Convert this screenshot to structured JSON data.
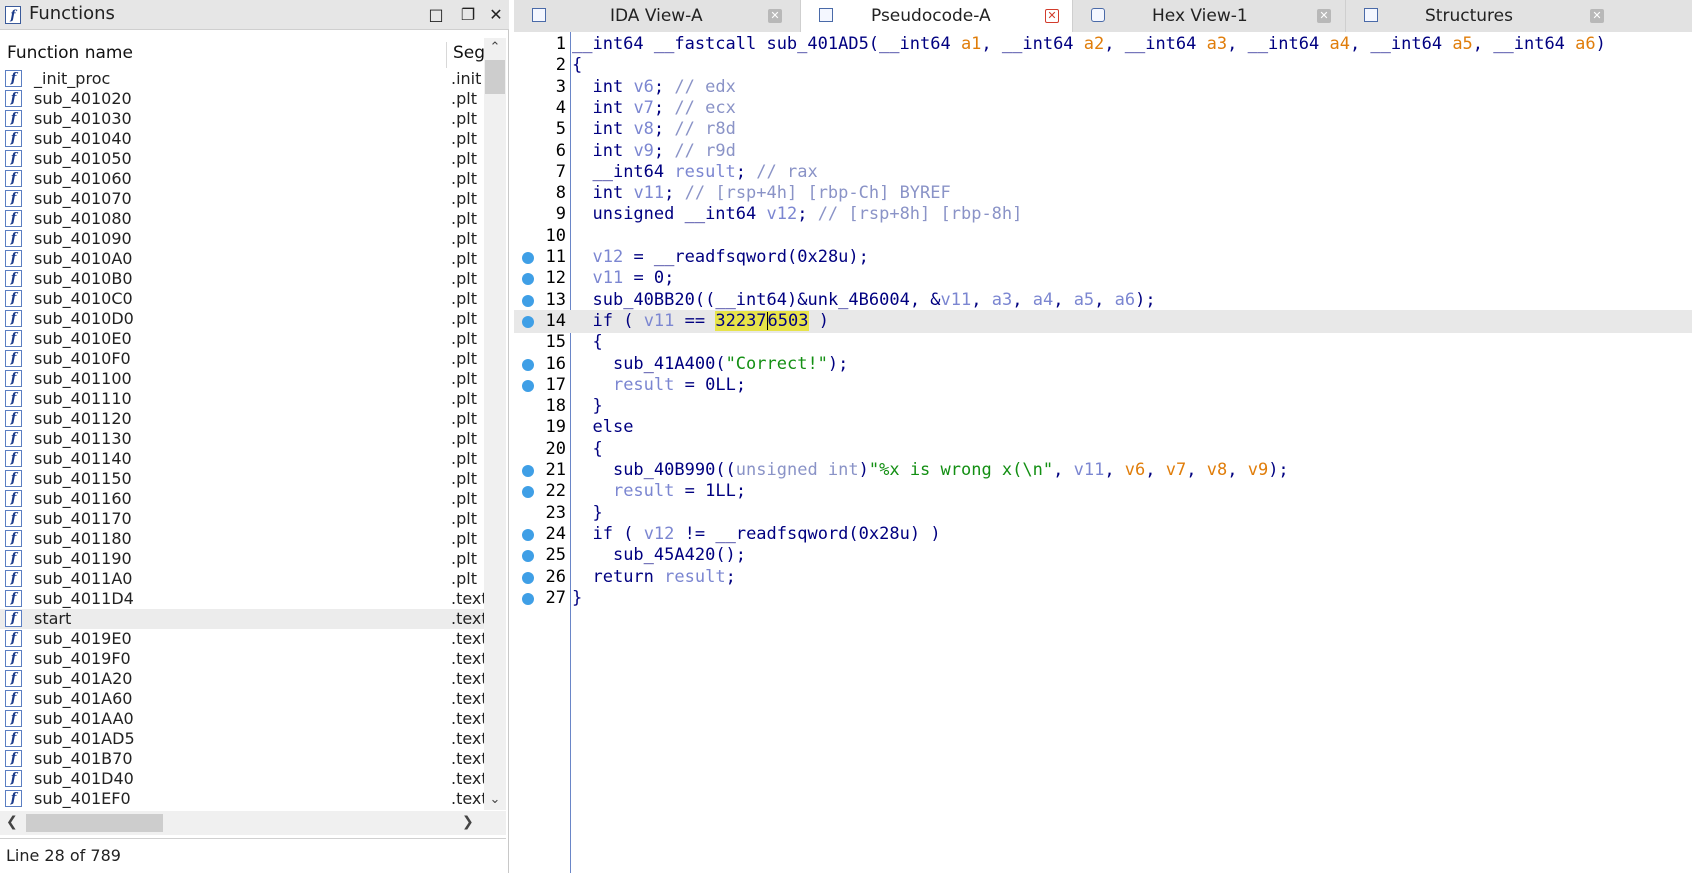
{
  "functions_panel": {
    "title": "Functions",
    "columns": {
      "name": "Function name",
      "segment": "Segment"
    },
    "status": "Line 28 of 789",
    "selected_row": 27,
    "rows": [
      {
        "name": "_init_proc",
        "segment": ".init"
      },
      {
        "name": "sub_401020",
        "segment": ".plt"
      },
      {
        "name": "sub_401030",
        "segment": ".plt"
      },
      {
        "name": "sub_401040",
        "segment": ".plt"
      },
      {
        "name": "sub_401050",
        "segment": ".plt"
      },
      {
        "name": "sub_401060",
        "segment": ".plt"
      },
      {
        "name": "sub_401070",
        "segment": ".plt"
      },
      {
        "name": "sub_401080",
        "segment": ".plt"
      },
      {
        "name": "sub_401090",
        "segment": ".plt"
      },
      {
        "name": "sub_4010A0",
        "segment": ".plt"
      },
      {
        "name": "sub_4010B0",
        "segment": ".plt"
      },
      {
        "name": "sub_4010C0",
        "segment": ".plt"
      },
      {
        "name": "sub_4010D0",
        "segment": ".plt"
      },
      {
        "name": "sub_4010E0",
        "segment": ".plt"
      },
      {
        "name": "sub_4010F0",
        "segment": ".plt"
      },
      {
        "name": "sub_401100",
        "segment": ".plt"
      },
      {
        "name": "sub_401110",
        "segment": ".plt"
      },
      {
        "name": "sub_401120",
        "segment": ".plt"
      },
      {
        "name": "sub_401130",
        "segment": ".plt"
      },
      {
        "name": "sub_401140",
        "segment": ".plt"
      },
      {
        "name": "sub_401150",
        "segment": ".plt"
      },
      {
        "name": "sub_401160",
        "segment": ".plt"
      },
      {
        "name": "sub_401170",
        "segment": ".plt"
      },
      {
        "name": "sub_401180",
        "segment": ".plt"
      },
      {
        "name": "sub_401190",
        "segment": ".plt"
      },
      {
        "name": "sub_4011A0",
        "segment": ".plt"
      },
      {
        "name": "sub_4011D4",
        "segment": ".text"
      },
      {
        "name": "start",
        "segment": ".text"
      },
      {
        "name": "sub_4019E0",
        "segment": ".text"
      },
      {
        "name": "sub_4019F0",
        "segment": ".text"
      },
      {
        "name": "sub_401A20",
        "segment": ".text"
      },
      {
        "name": "sub_401A60",
        "segment": ".text"
      },
      {
        "name": "sub_401AA0",
        "segment": ".text"
      },
      {
        "name": "sub_401AD5",
        "segment": ".text"
      },
      {
        "name": "sub_401B70",
        "segment": ".text"
      },
      {
        "name": "sub_401D40",
        "segment": ".text"
      },
      {
        "name": "sub_401EF0",
        "segment": ".text"
      }
    ]
  },
  "tabs": [
    {
      "label": "IDA View-A",
      "icon": "ida-view-icon",
      "active": false
    },
    {
      "label": "Pseudocode-A",
      "icon": "pseudocode-icon",
      "active": true
    },
    {
      "label": "Hex View-1",
      "icon": "hex-view-icon",
      "active": false
    },
    {
      "label": "Structures",
      "icon": "structures-icon",
      "active": false
    }
  ],
  "code": {
    "highlighted_line": 14,
    "lines": [
      {
        "n": "1",
        "dot": false,
        "html": "<span class='kw'>__int64 __fastcall sub_401AD5(__int64 </span><span class='arg'>a1</span><span class='p'>, __int64 </span><span class='arg'>a2</span><span class='p'>, __int64 </span><span class='arg'>a3</span><span class='p'>, __int64 </span><span class='arg'>a4</span><span class='p'>, __int64 </span><span class='arg'>a5</span><span class='p'>, __int64 </span><span class='arg'>a6</span><span class='p'>)</span>"
      },
      {
        "n": "2",
        "dot": false,
        "html": "<span class='p'>{</span>"
      },
      {
        "n": "3",
        "dot": false,
        "html": "<span class='cmt'>  </span><span class='kw'>int </span><span class='var'>v6</span><span class='p'>; </span><span class='cmt'>// edx</span>"
      },
      {
        "n": "4",
        "dot": false,
        "html": "<span class='cmt'>  </span><span class='kw'>int </span><span class='var'>v7</span><span class='p'>; </span><span class='cmt'>// ecx</span>"
      },
      {
        "n": "5",
        "dot": false,
        "html": "<span class='cmt'>  </span><span class='kw'>int </span><span class='var'>v8</span><span class='p'>; </span><span class='cmt'>// r8d</span>"
      },
      {
        "n": "6",
        "dot": false,
        "html": "<span class='cmt'>  </span><span class='kw'>int </span><span class='var'>v9</span><span class='p'>; </span><span class='cmt'>// r9d</span>"
      },
      {
        "n": "7",
        "dot": false,
        "html": "<span class='cmt'>  </span><span class='kw'>__int64 </span><span class='var'>result</span><span class='p'>; </span><span class='cmt'>// rax</span>"
      },
      {
        "n": "8",
        "dot": false,
        "html": "<span class='cmt'>  </span><span class='kw'>int </span><span class='var'>v11</span><span class='p'>; </span><span class='cmt'>// [rsp+4h] [rbp-Ch] BYREF</span>"
      },
      {
        "n": "9",
        "dot": false,
        "html": "<span class='cmt'>  </span><span class='kw'>unsigned __int64 </span><span class='var'>v12</span><span class='p'>; </span><span class='cmt'>// [rsp+8h] [rbp-8h]</span>"
      },
      {
        "n": "10",
        "dot": false,
        "html": ""
      },
      {
        "n": "11",
        "dot": true,
        "html": "<span class='cmt'>  </span><span class='var'>v12</span><span class='p'> = </span><span class='fn'>__readfsqword</span><span class='p'>(</span><span class='num'>0x28u</span><span class='p'>);</span>"
      },
      {
        "n": "12",
        "dot": true,
        "html": "<span class='cmt'>  </span><span class='var'>v11</span><span class='p'> = </span><span class='num'>0</span><span class='p'>;</span>"
      },
      {
        "n": "13",
        "dot": true,
        "html": "<span class='cmt'>  </span><span class='fn'>sub_40BB20</span><span class='p'>((</span><span class='kw'>__int64</span><span class='p'>)&amp;</span><span class='fn'>unk_4B6004</span><span class='p'>, &amp;</span><span class='var'>v11</span><span class='p'>, </span><span class='var'>a3</span><span class='p'>, </span><span class='var'>a4</span><span class='p'>, </span><span class='var'>a5</span><span class='p'>, </span><span class='var'>a6</span><span class='p'>);</span>"
      },
      {
        "n": "14",
        "dot": true,
        "html": "<span class='cmt'>  </span><span class='kw'>if</span><span class='p'> ( </span><span class='var'>v11</span><span class='p'> == </span><span class='hlnum'>32237<span class='caret'></span>6503</span><span class='p'> )</span>"
      },
      {
        "n": "15",
        "dot": false,
        "html": "<span class='p'>  {</span>"
      },
      {
        "n": "16",
        "dot": true,
        "html": "<span class='p'>    </span><span class='fn'>sub_41A400</span><span class='p'>(</span><span class='str'>\"Correct!\"</span><span class='p'>);</span>"
      },
      {
        "n": "17",
        "dot": true,
        "html": "<span class='p'>    </span><span class='var'>result</span><span class='p'> = </span><span class='num'>0LL</span><span class='p'>;</span>"
      },
      {
        "n": "18",
        "dot": false,
        "html": "<span class='p'>  }</span>"
      },
      {
        "n": "19",
        "dot": false,
        "html": "<span class='p'>  </span><span class='kw'>else</span>"
      },
      {
        "n": "20",
        "dot": false,
        "html": "<span class='p'>  {</span>"
      },
      {
        "n": "21",
        "dot": true,
        "html": "<span class='p'>    </span><span class='fn'>sub_40B990</span><span class='p'>((</span><span class='cmt'>unsigned int</span><span class='p'>)</span><span class='str'>\"%x is wrong x(\\n\"</span><span class='p'>, </span><span class='var'>v11</span><span class='p'>, </span><span class='arg'>v6</span><span class='p'>, </span><span class='arg'>v7</span><span class='p'>, </span><span class='arg'>v8</span><span class='p'>, </span><span class='arg'>v9</span><span class='p'>);</span>"
      },
      {
        "n": "22",
        "dot": true,
        "html": "<span class='p'>    </span><span class='var'>result</span><span class='p'> = </span><span class='num'>1LL</span><span class='p'>;</span>"
      },
      {
        "n": "23",
        "dot": false,
        "html": "<span class='p'>  }</span>"
      },
      {
        "n": "24",
        "dot": true,
        "html": "<span class='p'>  </span><span class='kw'>if</span><span class='p'> ( </span><span class='var'>v12</span><span class='p'> != </span><span class='fn'>__readfsqword</span><span class='p'>(</span><span class='num'>0x28u</span><span class='p'>) )</span>"
      },
      {
        "n": "25",
        "dot": true,
        "html": "<span class='p'>    </span><span class='fn'>sub_45A420</span><span class='p'>();</span>"
      },
      {
        "n": "26",
        "dot": true,
        "html": "<span class='p'>  </span><span class='kw'>return </span><span class='var'>result</span><span class='p'>;</span>"
      },
      {
        "n": "27",
        "dot": true,
        "html": "<span class='p'>}</span>"
      }
    ]
  },
  "colors": {
    "keyword": "#000080",
    "variable": "#7b86d1",
    "argument": "#e07d0a",
    "string": "#138f13",
    "comment": "#8a93c7",
    "breakpoint_dot": "#3f9fe6",
    "number_highlight": "#e7e34a"
  }
}
